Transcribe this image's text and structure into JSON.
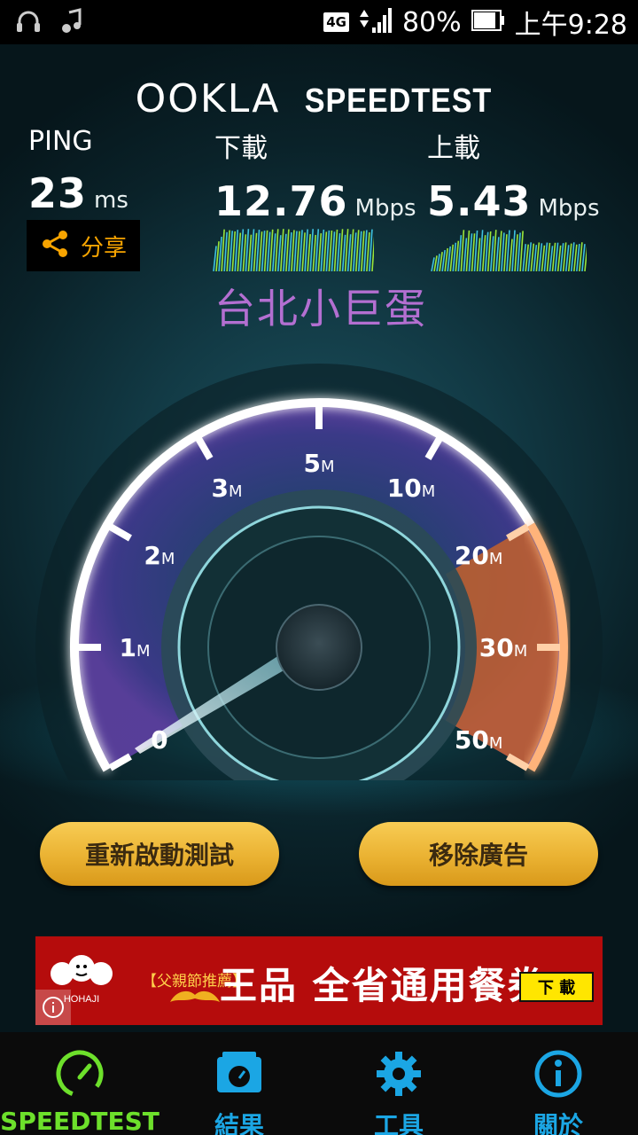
{
  "status_bar": {
    "network": "4G",
    "battery": "80%",
    "time": "上午9:28",
    "icons": [
      "headset-icon",
      "music-note-icon",
      "signal-icon",
      "battery-icon"
    ]
  },
  "header": {
    "logo_primary": "OOKLA",
    "logo_secondary": "SPEEDTEST"
  },
  "results": {
    "ping": {
      "label": "PING",
      "value": "23",
      "unit": "ms"
    },
    "download": {
      "label": "下載",
      "value": "12.76",
      "unit": "Mbps"
    },
    "upload": {
      "label": "上載",
      "value": "5.43",
      "unit": "Mbps"
    }
  },
  "share_button": {
    "label": "分享",
    "icon": "share-icon"
  },
  "watermark": "台北小巨蛋",
  "gauge": {
    "ticks": [
      {
        "num": "0",
        "suffix": ""
      },
      {
        "num": "1",
        "suffix": "M"
      },
      {
        "num": "2",
        "suffix": "M"
      },
      {
        "num": "3",
        "suffix": "M"
      },
      {
        "num": "5",
        "suffix": "M"
      },
      {
        "num": "10",
        "suffix": "M"
      },
      {
        "num": "20",
        "suffix": "M"
      },
      {
        "num": "30",
        "suffix": "M"
      },
      {
        "num": "50",
        "suffix": "M"
      }
    ]
  },
  "buttons": {
    "retest": "重新啟動測試",
    "remove_ads": "移除廣告"
  },
  "ad": {
    "brand": "HOHAJI",
    "tag": "【父親節推薦】",
    "headline": "王品 全省通用餐券",
    "cta": "下 載"
  },
  "bottom_nav": {
    "items": [
      {
        "label": "SPEEDTEST",
        "icon": "gauge-icon",
        "active": true
      },
      {
        "label": "結果",
        "icon": "results-icon",
        "active": false
      },
      {
        "label": "工具",
        "icon": "gear-icon",
        "active": false
      },
      {
        "label": "關於",
        "icon": "info-icon",
        "active": false
      }
    ]
  },
  "colors": {
    "accent_active": "#6de02b",
    "accent_nav": "#1ba6e4",
    "share_orange": "#f7a400",
    "button_gold": "#eab232",
    "ad_red": "#b50c0c"
  }
}
